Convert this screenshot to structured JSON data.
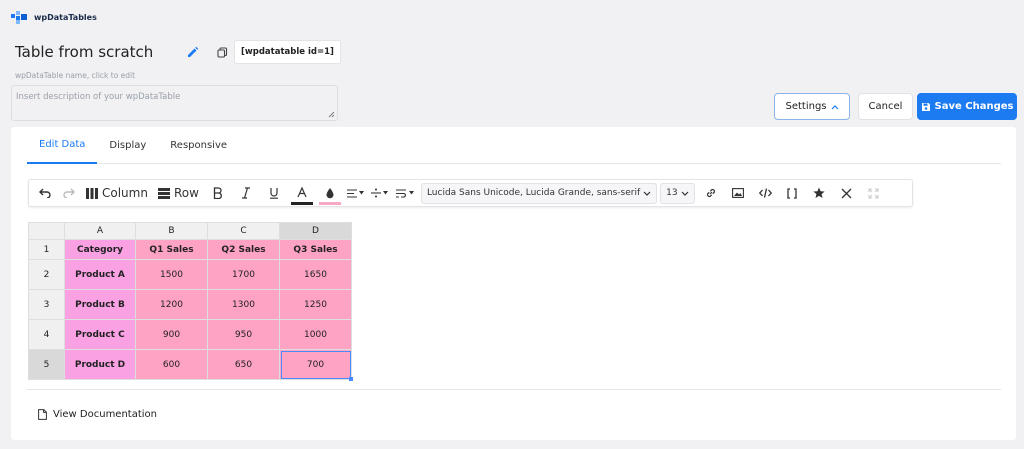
{
  "brand": {
    "name": "wpDataTables",
    "accent": "#1d7bf2"
  },
  "header": {
    "table_name": "Table from scratch",
    "shortcode": "[wpdatatable id=1]",
    "name_hint": "wpDataTable name, click to edit",
    "description_placeholder": "Insert description of your wpDataTable"
  },
  "actions": {
    "settings": "Settings",
    "cancel": "Cancel",
    "save": "Save Changes"
  },
  "tabs": [
    {
      "label": "Edit Data",
      "active": true
    },
    {
      "label": "Display",
      "active": false
    },
    {
      "label": "Responsive",
      "active": false
    }
  ],
  "toolbar": {
    "column_label": "Column",
    "row_label": "Row",
    "font_family": "Lucida Sans Unicode, Lucida Grande, sans-serif",
    "font_size": "13",
    "text_color": "#222222",
    "fill_color": "#f7a8c4",
    "icons": [
      "undo-icon",
      "redo-icon",
      "column-icon",
      "row-icon",
      "bold-icon",
      "italic-icon",
      "underline-icon",
      "text-color-icon",
      "fill-color-icon",
      "align-icon",
      "valign-icon",
      "wrap-icon",
      "link-icon",
      "image-icon",
      "code-icon",
      "shortcode-icon",
      "star-icon",
      "clear-icon",
      "fullscreen-icon"
    ]
  },
  "sheet": {
    "columns": [
      "A",
      "B",
      "C",
      "D"
    ],
    "header_row": {
      "num": "1",
      "cells": [
        "Category",
        "Q1 Sales",
        "Q2 Sales",
        "Q3 Sales"
      ]
    },
    "rows": [
      {
        "num": "2",
        "cells": [
          "Product A",
          "1500",
          "1700",
          "1650"
        ]
      },
      {
        "num": "3",
        "cells": [
          "Product B",
          "1200",
          "1300",
          "1250"
        ]
      },
      {
        "num": "4",
        "cells": [
          "Product C",
          "900",
          "950",
          "1000"
        ]
      },
      {
        "num": "5",
        "cells": [
          "Product D",
          "600",
          "650",
          "700"
        ]
      }
    ],
    "category_color": "#f9a1e3",
    "value_color": "#ffa3c5"
  },
  "footer": {
    "doc_link": "View Documentation"
  }
}
